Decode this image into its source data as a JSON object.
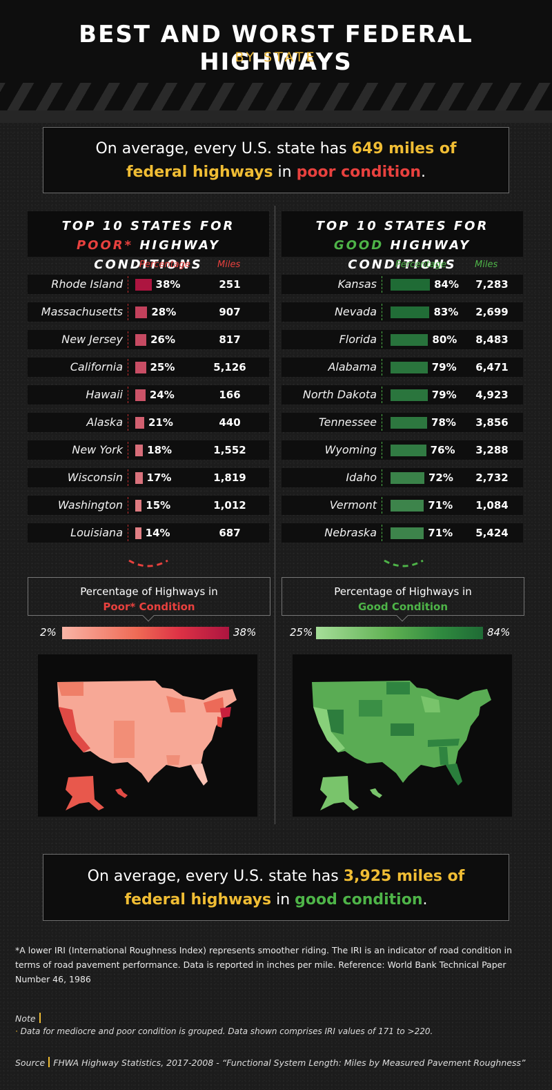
{
  "header": {
    "title": "BEST AND WORST FEDERAL HIGHWAYS",
    "subtitle": "BY STATE"
  },
  "callout_top": {
    "prefix": "On average, every U.S. state has ",
    "highlight1": "649 miles of",
    "highlight2": "federal highways",
    "middle": " in ",
    "condition": "poor condition",
    "suffix": "."
  },
  "callout_bottom": {
    "prefix": "On average, every U.S. state has ",
    "highlight1": "3,925 miles of",
    "highlight2": "federal highways",
    "middle": " in ",
    "condition": "good condition",
    "suffix": "."
  },
  "poor_panel": {
    "heading_line1": "TOP 10 STATES FOR",
    "heading_accent": "POOR*",
    "heading_rest": " HIGHWAY CONDITIONS",
    "col_percentage": "Percentage",
    "col_miles": "Miles",
    "legend_line1": "Percentage of Highways in",
    "legend_line2": "Poor* Condition",
    "scale_min": "2%",
    "scale_max": "38%"
  },
  "good_panel": {
    "heading_line1": "TOP 10 STATES FOR",
    "heading_accent": "GOOD",
    "heading_rest": " HIGHWAY CONDITIONS",
    "col_percentage": "Percentage",
    "col_miles": "Miles",
    "legend_line1": "Percentage of Highways in",
    "legend_line2": "Good Condition",
    "scale_min": "25%",
    "scale_max": "84%"
  },
  "colors": {
    "accent_yellow": "#f0bd34",
    "poor_red": "#e8413e",
    "good_green": "#4eb448"
  },
  "chart_data": [
    {
      "type": "bar",
      "title": "Top 10 States for Poor* Highway Conditions",
      "categories": [
        "Rhode Island",
        "Massachusetts",
        "New Jersey",
        "California",
        "Hawaii",
        "Alaska",
        "New York",
        "Wisconsin",
        "Washington",
        "Louisiana"
      ],
      "series": [
        {
          "name": "Percentage",
          "values": [
            38,
            28,
            26,
            25,
            24,
            21,
            18,
            17,
            15,
            14
          ],
          "labels": [
            "38%",
            "28%",
            "26%",
            "25%",
            "24%",
            "21%",
            "18%",
            "17%",
            "15%",
            "14%"
          ]
        },
        {
          "name": "Miles",
          "values": [
            251,
            907,
            817,
            5126,
            166,
            440,
            1552,
            1819,
            1012,
            687
          ],
          "labels": [
            "251",
            "907",
            "817",
            "5,126",
            "166",
            "440",
            "1,552",
            "1,819",
            "1,012",
            "687"
          ]
        }
      ],
      "color_scale": {
        "min": 2,
        "max": 38,
        "min_color": "#f9b4a6",
        "max_color": "#ad1540"
      }
    },
    {
      "type": "bar",
      "title": "Top 10 States for Good Highway Conditions",
      "categories": [
        "Kansas",
        "Nevada",
        "Florida",
        "Alabama",
        "North Dakota",
        "Tennessee",
        "Wyoming",
        "Idaho",
        "Vermont",
        "Nebraska"
      ],
      "series": [
        {
          "name": "Percentage",
          "values": [
            84,
            83,
            80,
            79,
            79,
            78,
            76,
            72,
            71,
            71
          ],
          "labels": [
            "84%",
            "83%",
            "80%",
            "79%",
            "79%",
            "78%",
            "76%",
            "72%",
            "71%",
            "71%"
          ]
        },
        {
          "name": "Miles",
          "values": [
            7283,
            2699,
            8483,
            6471,
            4923,
            3856,
            3288,
            2732,
            1084,
            5424
          ],
          "labels": [
            "7,283",
            "2,699",
            "8,483",
            "6,471",
            "4,923",
            "3,856",
            "3,288",
            "2,732",
            "1,084",
            "5,424"
          ]
        }
      ],
      "color_scale": {
        "min": 25,
        "max": 84,
        "min_color": "#a6de99",
        "max_color": "#1f6b35"
      }
    }
  ],
  "footnote": "*A lower IRI (International Roughness Index) represents smoother riding. The IRI is an indicator of road condition in terms of road pavement performance. Data is reported in inches per mile. Reference: World Bank Technical Paper Number 46, 1986",
  "note": {
    "label": "Note",
    "bullet": "·",
    "text": " Data for mediocre and poor condition is grouped. Data shown comprises IRI values of 171 to >220."
  },
  "source": {
    "label": "Source",
    "text": "FHWA Highway Statistics, 2017-2008 - “Functional System Length: Miles by Measured Pavement Roughness”"
  }
}
